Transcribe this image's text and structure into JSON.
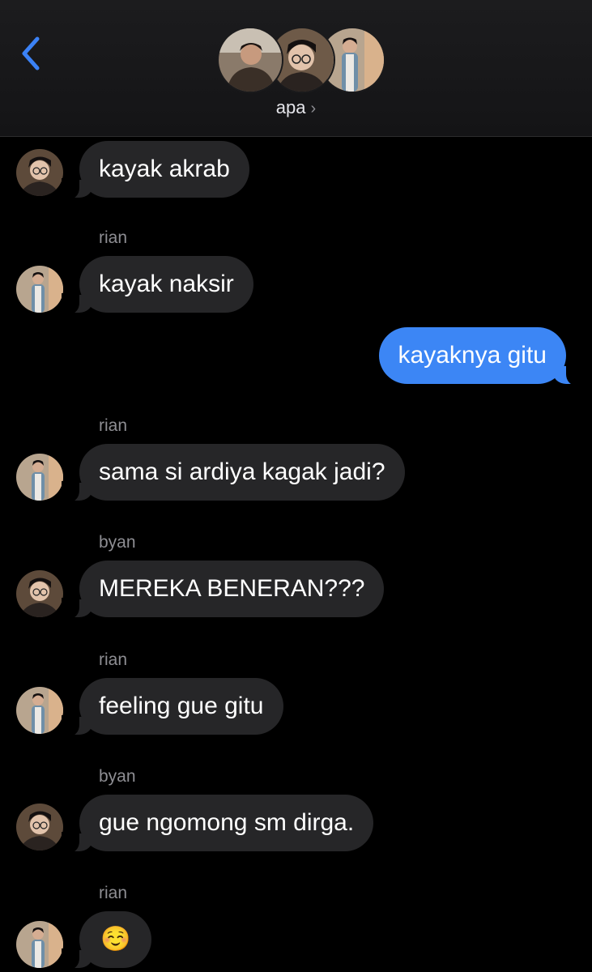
{
  "header": {
    "group_name": "apa",
    "chevron": "›",
    "back_icon": "chevron-left-icon"
  },
  "colors": {
    "incoming_bubble": "#262628",
    "outgoing_bubble": "#3c86f5",
    "background": "#000000",
    "sender_text": "#8e8e93",
    "back_accent": "#3b82f6"
  },
  "messages": [
    {
      "sender": "",
      "avatar": "byan",
      "text": "kayak akrab"
    },
    {
      "sender": "rian",
      "avatar": "rian",
      "text": "kayak naksir"
    },
    {
      "sender": "me",
      "text": "kayaknya gitu"
    },
    {
      "sender": "rian",
      "avatar": "rian",
      "text": "sama si ardiya kagak jadi?"
    },
    {
      "sender": "byan",
      "avatar": "byan",
      "text": "MEREKA BENERAN???"
    },
    {
      "sender": "rian",
      "avatar": "rian",
      "text": "feeling gue gitu"
    },
    {
      "sender": "byan",
      "avatar": "byan",
      "text": "gue ngomong sm dirga."
    },
    {
      "sender": "rian",
      "avatar": "rian",
      "text": "☺️"
    }
  ]
}
